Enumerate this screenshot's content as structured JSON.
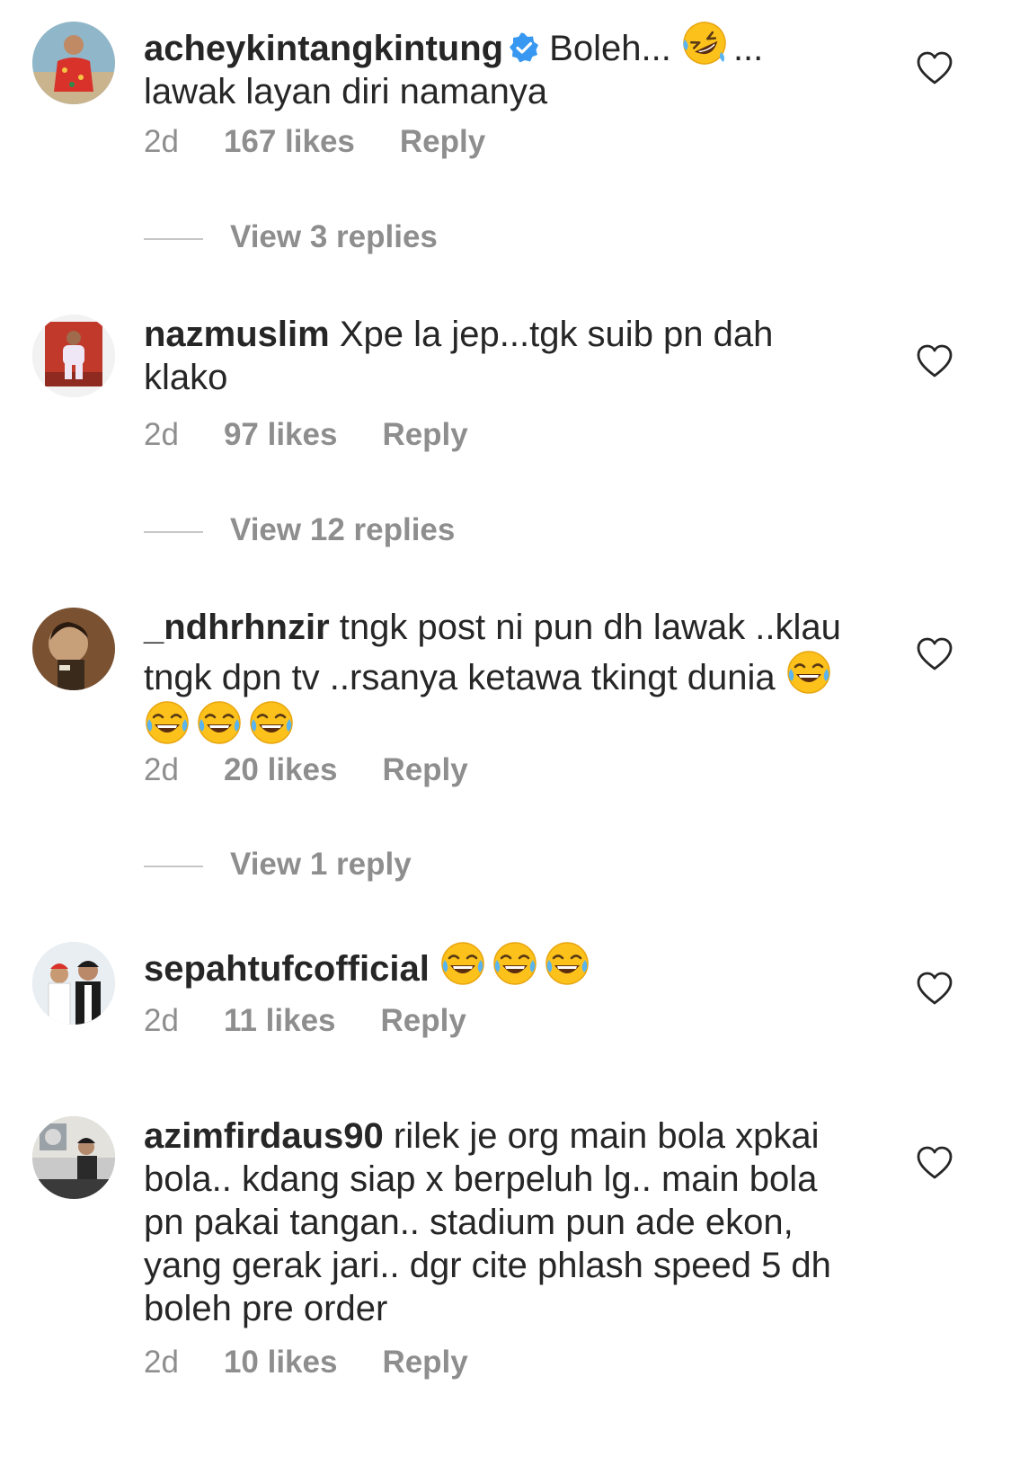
{
  "comments": [
    {
      "username": "acheykintangkintung",
      "verified": true,
      "text_before_emoji": " Boleh... ",
      "emoji": "rolling-on-floor-laughing",
      "text_after_emoji": "...",
      "text_line2": "lawak layan diri namanya",
      "time": "2d",
      "likes": "167 likes",
      "reply": "Reply",
      "view_replies": "View 3 replies"
    },
    {
      "username": "nazmuslim",
      "text": " Xpe la jep...tgk suib pn dah klako",
      "time": "2d",
      "likes": "97 likes",
      "reply": "Reply",
      "view_replies": "View 12 replies"
    },
    {
      "username": "_ndhrhnzir",
      "text": " tngk post ni pun dh lawak ..klau tngk dpn tv ..rsanya ketawa tkingt dunia ",
      "emoji": "face-with-tears-of-joy",
      "emoji_count": 4,
      "time": "2d",
      "likes": "20 likes",
      "reply": "Reply",
      "view_replies": "View 1 reply"
    },
    {
      "username": "sepahtufcofficial",
      "emoji": "face-with-tears-of-joy",
      "emoji_count": 3,
      "time": "2d",
      "likes": "11 likes",
      "reply": "Reply"
    },
    {
      "username": "azimfirdaus90",
      "text": " rilek je org main bola xpkai bola.. kdang siap x berpeluh lg.. main bola pn pakai tangan.. stadium pun ade ekon, yang gerak jari.. dgr cite phlash speed 5 dh boleh pre order",
      "time": "2d",
      "likes": "10 likes",
      "reply": "Reply"
    }
  ],
  "colors": {
    "text": "#262626",
    "secondary": "#8e8e8e",
    "verified": "#3897f0",
    "divider": "#c7c7c7"
  }
}
